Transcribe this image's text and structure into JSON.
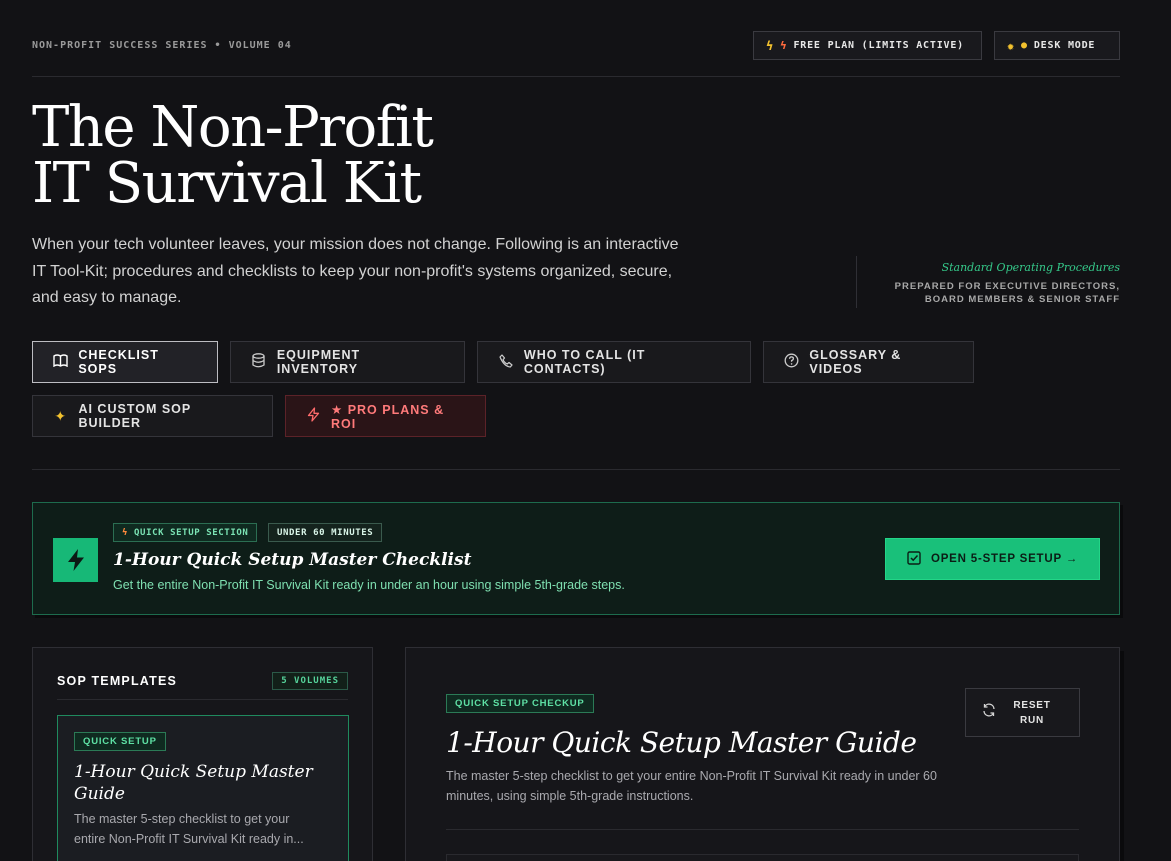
{
  "header": {
    "series": "NON-PROFIT SUCCESS SERIES • VOLUME 04",
    "plan_label": "FREE PLAN (LIMITS ACTIVE)",
    "mode_label": "DESK MODE"
  },
  "hero": {
    "title_line1": "The Non-Profit",
    "title_line2": "IT Survival Kit",
    "intro": "When your tech volunteer leaves, your mission does not change. Following is an interactive IT Tool-Kit; procedures and checklists to keep your non-profit's systems organized, secure, and easy to manage.",
    "sop_title": "Standard Operating Procedures",
    "sop_sub_line1": "PREPARED FOR EXECUTIVE DIRECTORS,",
    "sop_sub_line2": "BOARD MEMBERS & SENIOR STAFF"
  },
  "tabs": [
    {
      "label": "CHECKLIST SOPS",
      "icon": "book-icon"
    },
    {
      "label": "EQUIPMENT INVENTORY",
      "icon": "database-icon"
    },
    {
      "label": "WHO TO CALL (IT CONTACTS)",
      "icon": "phone-icon"
    },
    {
      "label": "GLOSSARY & VIDEOS",
      "icon": "help-circle-icon"
    },
    {
      "label": "AI CUSTOM SOP BUILDER",
      "icon": "sparkles-icon"
    },
    {
      "label": "★ PRO PLANS & ROI",
      "icon": "bolt-icon"
    }
  ],
  "banner": {
    "tag1": "QUICK SETUP SECTION",
    "tag2": "UNDER 60 MINUTES",
    "title": "1-Hour Quick Setup Master Checklist",
    "desc": "Get the entire Non-Profit IT Survival Kit ready in under an hour using simple 5th-grade steps.",
    "button": "OPEN 5-STEP SETUP →"
  },
  "templates": {
    "heading": "SOP TEMPLATES",
    "count_badge": "5 VOLUMES",
    "card": {
      "badge": "QUICK SETUP",
      "title": "1-Hour Quick Setup Master Guide",
      "desc": "The master 5-step checklist to get your entire Non-Profit IT Survival Kit ready in..."
    }
  },
  "guide": {
    "badge": "QUICK SETUP CHECKUP",
    "title": "1-Hour Quick Setup Master Guide",
    "desc": "The master 5-step checklist to get your entire Non-Profit IT Survival Kit ready in under 60 minutes, using simple 5th-grade instructions.",
    "reset_line1": "RESET",
    "reset_line2": "RUN"
  },
  "colors": {
    "background": "#121215",
    "accent_green": "#19c07a",
    "pro_red": "#ff7a7a",
    "warning_yellow": "#f2c12e"
  }
}
